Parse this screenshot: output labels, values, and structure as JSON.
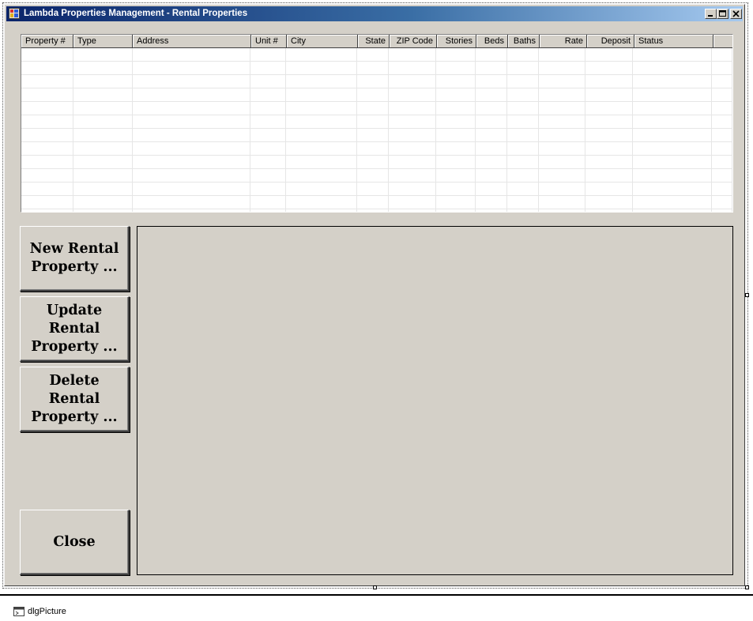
{
  "window": {
    "title": "Lambda Properties Management - Rental Properties",
    "controls": [
      "minimize",
      "maximize",
      "close"
    ]
  },
  "grid": {
    "columns": [
      {
        "label": "Property #",
        "align": "left"
      },
      {
        "label": "Type",
        "align": "left"
      },
      {
        "label": "Address",
        "align": "left"
      },
      {
        "label": "Unit #",
        "align": "left"
      },
      {
        "label": "City",
        "align": "left"
      },
      {
        "label": "State",
        "align": "right"
      },
      {
        "label": "ZIP Code",
        "align": "right"
      },
      {
        "label": "Stories",
        "align": "right"
      },
      {
        "label": "Beds",
        "align": "right"
      },
      {
        "label": "Baths",
        "align": "right"
      },
      {
        "label": "Rate",
        "align": "right"
      },
      {
        "label": "Deposit",
        "align": "right"
      },
      {
        "label": "Status",
        "align": "left"
      }
    ],
    "rows": []
  },
  "buttons": {
    "new_property": "New Rental\nProperty ...",
    "update_property": "Update\nRental\nProperty ...",
    "delete_property": "Delete\nRental\nProperty ...",
    "close": "Close"
  },
  "component_tray": {
    "items": [
      {
        "label": "dlgPicture",
        "icon": "dialog-icon"
      }
    ]
  },
  "colors": {
    "face": "#d4d0c8",
    "title_start": "#0a246a",
    "title_end": "#a6caf0"
  }
}
